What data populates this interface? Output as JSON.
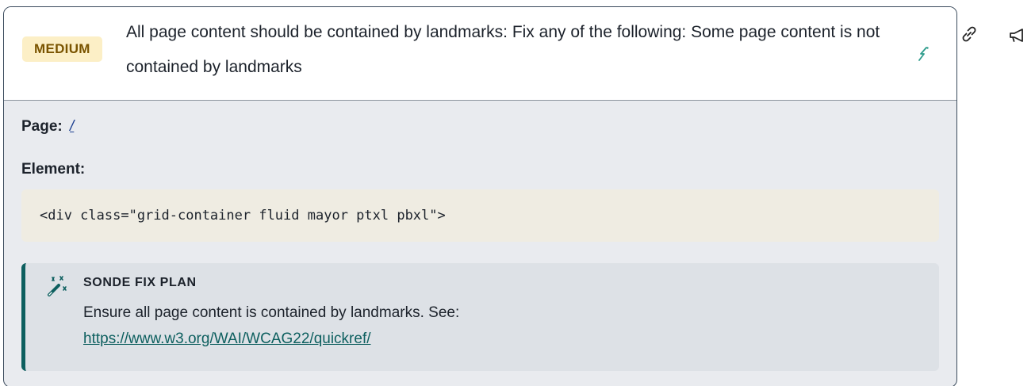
{
  "issue": {
    "severity": "MEDIUM",
    "title": "All page content should be contained by landmarks: Fix any of the following: Some page content is not contained by landmarks",
    "page_label": "Page:",
    "page_link": "/",
    "element_label": "Element:",
    "element_code": "<div class=\"grid-container fluid mayor ptxl pbxl\">"
  },
  "fix_plan": {
    "title": "SONDE FIX PLAN",
    "text": "Ensure all page content is contained by landmarks. See:",
    "link": "https://www.w3.org/WAI/WCAG22/quickref/"
  },
  "icons": {
    "header_action": "auto-fix-icon",
    "fix_plan": "magic-wand-icon",
    "side_link": "link-icon",
    "side_report": "megaphone-icon"
  },
  "colors": {
    "severity_bg": "#fcefc6",
    "severity_text": "#7a5400",
    "accent": "#0d5f5f",
    "code_bg": "#efece2",
    "card_bg": "#e9ebef",
    "border": "#3a4a5c"
  }
}
